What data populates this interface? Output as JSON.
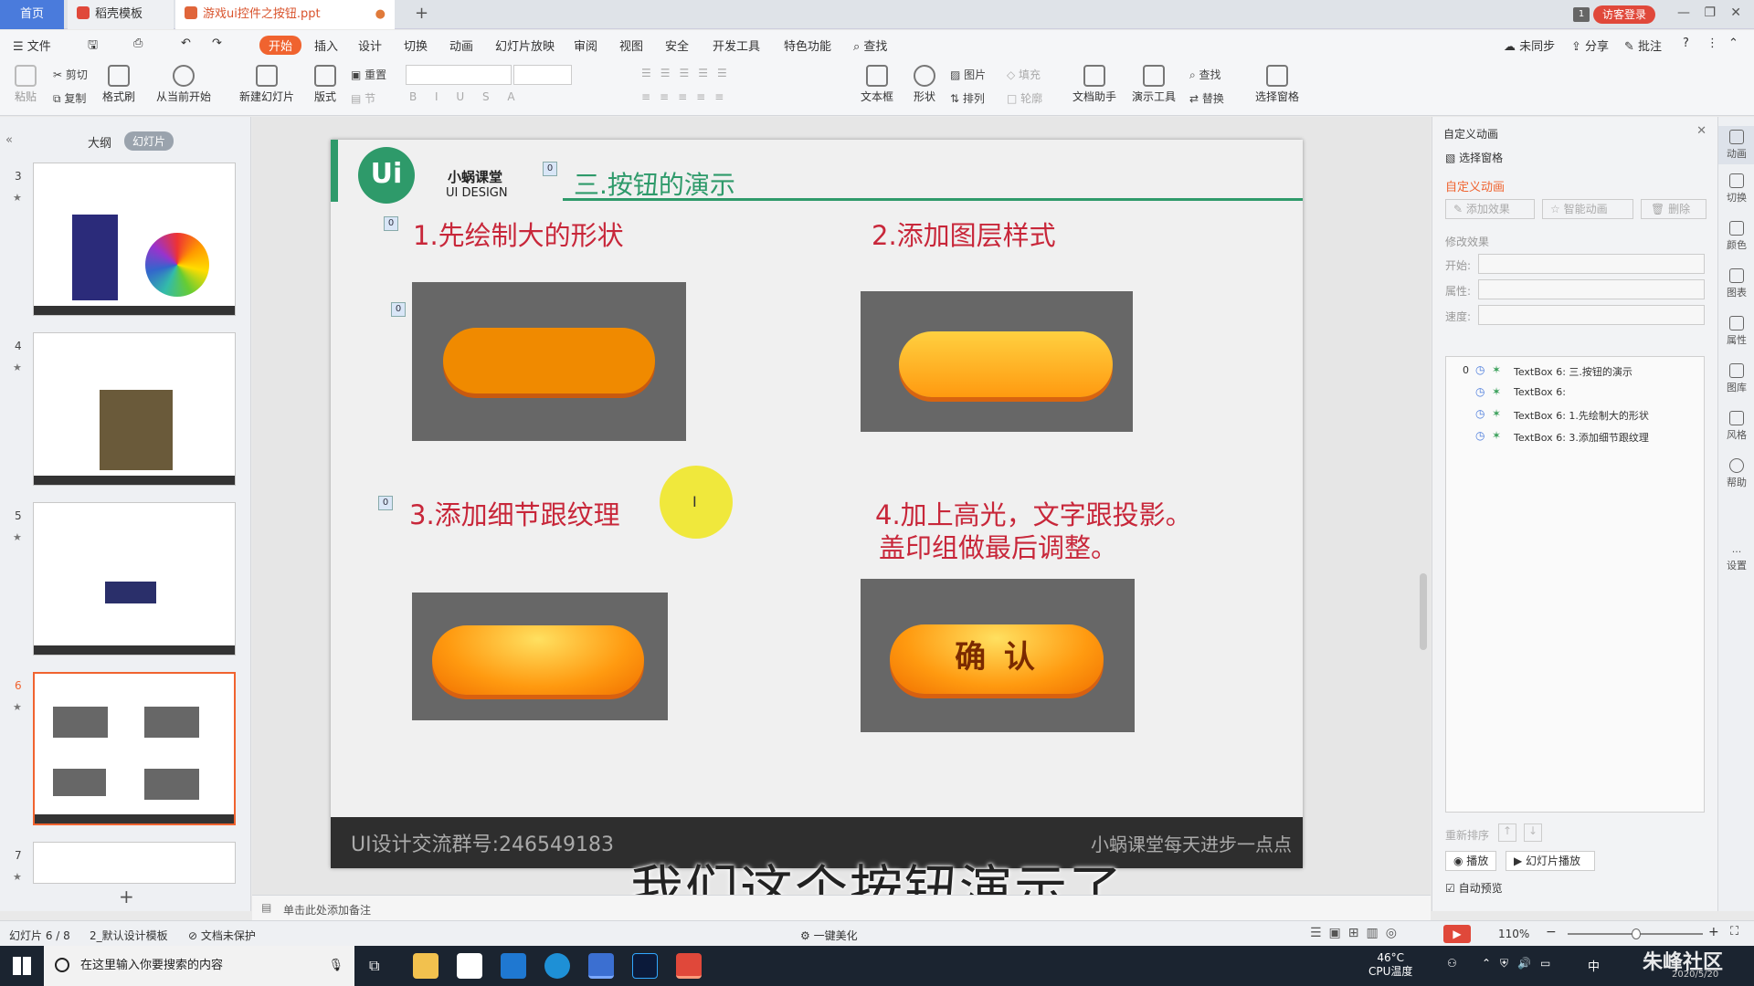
{
  "tabs": {
    "home": "首页",
    "template": "稻壳模板",
    "file": "游戏ui控件之按钮.ppt"
  },
  "titlebar": {
    "count_badge": "1",
    "login": "访客登录"
  },
  "menu": {
    "file": "文件",
    "items": [
      "开始",
      "插入",
      "设计",
      "切换",
      "动画",
      "幻灯片放映",
      "审阅",
      "视图",
      "安全",
      "开发工具",
      "特色功能"
    ],
    "search": "查找",
    "right": [
      "未同步",
      "分享",
      "批注"
    ]
  },
  "ribbon": {
    "paste": "粘贴",
    "cut": "剪切",
    "copy": "复制",
    "format_painter": "格式刷",
    "from_current": "从当前开始",
    "new_slide": "新建幻灯片",
    "layout": "版式",
    "reset": "重置",
    "section": "节",
    "textbox": "文本框",
    "shape": "形状",
    "arrange": "排列",
    "picture": "图片",
    "fill": "填充",
    "outline": "轮廓",
    "doc_assistant": "文档助手",
    "presentation_tools": "演示工具",
    "find": "查找",
    "replace": "替换",
    "select_pane": "选择窗格"
  },
  "left_panel": {
    "tab_outline": "大纲",
    "tab_slides": "幻灯片",
    "slide_numbers": [
      "3",
      "4",
      "5",
      "6",
      "7"
    ],
    "add": "+"
  },
  "slide": {
    "logo_text": "Ui",
    "brand_cn": "小蜗课堂",
    "brand_en": "UI DESIGN",
    "title": "三.按钮的演示",
    "anim_tag": "0",
    "steps": [
      "1.先绘制大的形状",
      "2.添加图层样式",
      "3.添加细节跟纹理",
      "4.加上高光，文字跟投影。",
      "盖印组做最后调整。"
    ],
    "confirm_label": "确 认",
    "footer_left": "UI设计交流群号:246549183",
    "footer_right": "小蜗课堂每天进步一点点"
  },
  "subtitle": "我们这个按钮演示了",
  "right_panel": {
    "header": "自定义动画",
    "select_pane": "选择窗格",
    "section_title": "自定义动画",
    "add_effect": "添加效果",
    "smart_anim": "智能动画",
    "delete": "删除",
    "modify": "修改效果",
    "start_label": "开始:",
    "property_label": "属性:",
    "speed_label": "速度:",
    "anim_list": [
      {
        "index": "0",
        "text": "TextBox 6: 三.按钮的演示"
      },
      {
        "index": "",
        "text": "TextBox 6:"
      },
      {
        "index": "",
        "text": "TextBox 6: 1.先绘制大的形状"
      },
      {
        "index": "",
        "text": "TextBox 6: 3.添加细节跟纹理"
      }
    ],
    "reorder": "重新排序",
    "play": "播放",
    "slideshow": "幻灯片播放",
    "auto_preview": "自动预览"
  },
  "sidebar": [
    "动画",
    "切换",
    "颜色",
    "图表",
    "属性",
    "图库",
    "风格",
    "帮助",
    "设置"
  ],
  "notes": {
    "placeholder": "单击此处添加备注"
  },
  "statusbar": {
    "slide_info": "幻灯片 6 / 8",
    "template": "2_默认设计模板",
    "protect": "文档未保护",
    "beautify": "一键美化",
    "zoom": "110%"
  },
  "taskbar": {
    "search_placeholder": "在这里输入你要搜索的内容",
    "cpu_temp": "46°C",
    "cpu_label": "CPU温度",
    "ime": "中",
    "date": "2020/5/20",
    "watermark": "朱峰社区"
  },
  "colors": {
    "accent": "#f0632f",
    "slide_title": "#2e9a6a",
    "step_red": "#c8273a",
    "button_orange": "#f08a00"
  }
}
